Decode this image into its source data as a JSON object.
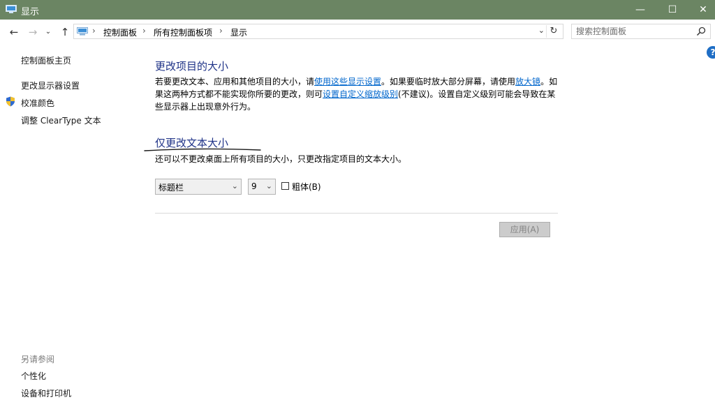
{
  "window": {
    "title": "显示",
    "minimize_glyph": "—",
    "maximize_glyph": "☐",
    "close_glyph": "✕"
  },
  "nav": {
    "back_icon": "back-arrow-icon",
    "forward_icon": "forward-arrow-icon",
    "recent_icon": "recent-locations-chevron-icon",
    "up_icon": "up-arrow-icon",
    "breadcrumb": [
      "控制面板",
      "所有控制面板项",
      "显示"
    ],
    "separator": "›",
    "search_placeholder": "搜索控制面板"
  },
  "sidebar": {
    "home": "控制面板主页",
    "items": [
      "更改显示器设置",
      "校准颜色",
      "调整 ClearType 文本"
    ],
    "see_also_title": "另请参阅",
    "see_also": [
      "个性化",
      "设备和打印机"
    ]
  },
  "main": {
    "section1_title": "更改项目的大小",
    "section1_text_a": "若要更改文本、应用和其他项目的大小，请",
    "section1_link1": "使用这些显示设置",
    "section1_text_b": "。如果要临时放大部分屏幕，请使用",
    "section1_link2": "放大镜",
    "section1_text_c": "。如果这两种方式都不能实现你所要的更改，则可",
    "section1_link3": "设置自定义缩放级别",
    "section1_text_d": "(不建议)。设置自定义级别可能会导致在某些显示器上出现意外行为。",
    "section2_title": "仅更改文本大小",
    "section2_text": "还可以不更改桌面上所有项目的大小，只更改指定项目的文本大小。",
    "item_select": "标题栏",
    "size_select": "9",
    "bold_label": "粗体(B)",
    "bold_checked": false,
    "apply_label": "应用(A)"
  },
  "colors": {
    "titlebar": "#6b8563",
    "heading": "#1e3287",
    "link": "#0066cc",
    "help": "#1f6ec5"
  }
}
